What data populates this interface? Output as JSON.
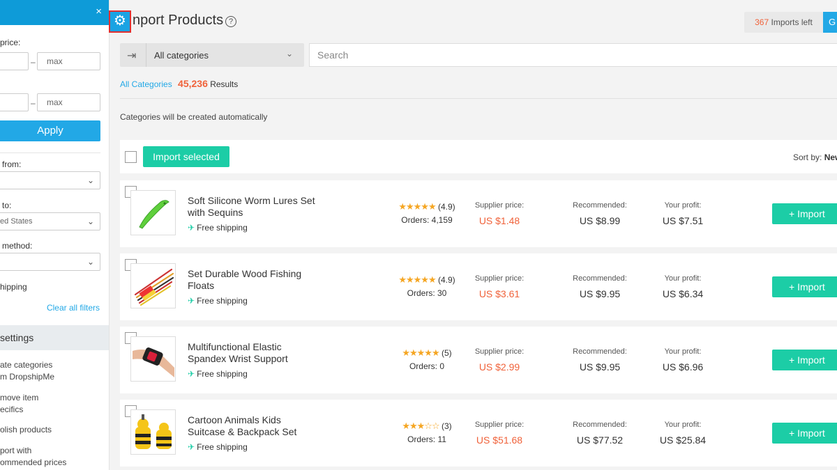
{
  "sidebar": {
    "close": "×",
    "price_label": "price:",
    "min_price_placeholder": "",
    "max_price_placeholder": "max",
    "dash": "–",
    "second_max_placeholder": "max",
    "apply_label": "Apply",
    "ship_from_label": "from:",
    "ship_from_value": "",
    "ship_to_label": "to:",
    "ship_to_value": "ted States",
    "method_label": "method:",
    "method_value": "",
    "free_shipping_label": "hipping",
    "clear_filters": "Clear all filters",
    "settings_title": "settings",
    "settings_items": [
      {
        "line1": "ate categories",
        "line2": "m DropshipMe"
      },
      {
        "line1": "move item",
        "line2": "ecifics"
      },
      {
        "line1": "olish products",
        "line2": ""
      },
      {
        "line1": "port with",
        "line2": "ommended prices"
      }
    ]
  },
  "header": {
    "title": "nport Products",
    "help": "?",
    "imports_left_count": "367",
    "imports_left_text": "Imports left",
    "go_label": "G"
  },
  "search": {
    "category_value": "All categories",
    "placeholder": "Search"
  },
  "results": {
    "link": "All Categories",
    "count": "45,236",
    "label": "Results"
  },
  "auto_note": "Categories will be created automatically",
  "toolbar": {
    "import_selected": "Import selected",
    "sort_by_label": "Sort by:",
    "sort_by_value": "New"
  },
  "labels": {
    "supplier": "Supplier price:",
    "recommended": "Recommended:",
    "profit": "Your profit:",
    "import": "+ Import",
    "free_shipping": "Free shipping",
    "orders_prefix": "Orders:"
  },
  "products": [
    {
      "title_l1": "Soft Silicone Worm Lures Set",
      "title_l2": "with Sequins",
      "stars": "★★★★★",
      "rating": "(4.9)",
      "orders": "4,159",
      "supplier": "US $1.48",
      "recommended": "US $8.99",
      "profit": "US $7.51",
      "thumb": "worm-lure"
    },
    {
      "title_l1": "Set Durable Wood Fishing",
      "title_l2": "Floats",
      "stars": "★★★★★",
      "rating": "(4.9)",
      "orders": "30",
      "supplier": "US $3.61",
      "recommended": "US $9.95",
      "profit": "US $6.34",
      "thumb": "fishing-floats"
    },
    {
      "title_l1": "Multifunctional Elastic",
      "title_l2": "Spandex Wrist Support",
      "stars": "★★★★★",
      "rating": "(5)",
      "orders": "0",
      "supplier": "US $2.99",
      "recommended": "US $9.95",
      "profit": "US $6.96",
      "thumb": "wrist-support"
    },
    {
      "title_l1": "Cartoon Animals Kids",
      "title_l2": "Suitcase & Backpack Set",
      "stars": "★★★☆☆",
      "rating": "(3)",
      "orders": "11",
      "supplier": "US $51.68",
      "recommended": "US $77.52",
      "profit": "US $25.84",
      "thumb": "bee-suitcase"
    }
  ]
}
